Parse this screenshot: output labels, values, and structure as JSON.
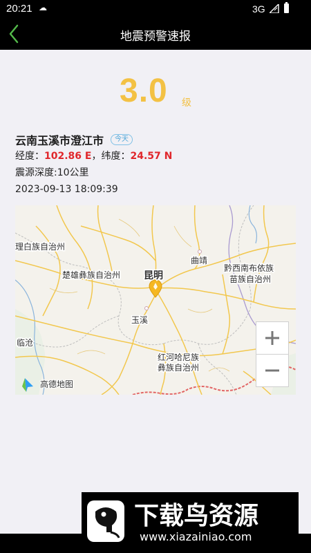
{
  "status_bar": {
    "time": "20:21",
    "network": "3G"
  },
  "app_bar": {
    "title": "地震预警速报"
  },
  "quake": {
    "magnitude": "3.0",
    "magnitude_unit": "级",
    "location": "云南玉溪市澄江市",
    "today_badge": "今天",
    "longitude_label": "经度：",
    "longitude_value": "102.86 E",
    "separator": "，",
    "latitude_label": "纬度：",
    "latitude_value": "24.57 N",
    "depth": "震源深度:10公里",
    "time": "2023-09-13 18:09:39"
  },
  "map": {
    "labels": {
      "dali": "理白族自治州",
      "chuxiong": "楚雄彝族自治州",
      "kunming": "昆明",
      "qujing": "曲靖",
      "qianxinan_1": "黔西南布依族",
      "qianxinan_2": "苗族自治州",
      "yuxi": "玉溪",
      "lincang": "临沧",
      "honghe_1": "红河哈尼族",
      "honghe_2": "彝族自治州",
      "logo": "高德地图"
    },
    "marker_color": "#f5b722"
  },
  "watermark": {
    "brand": "下载鸟资源",
    "url": "www.xiazainiao.com"
  },
  "colors": {
    "accent": "#f3c144",
    "emphasis": "#e0262b",
    "back_arrow": "#53b94a"
  }
}
